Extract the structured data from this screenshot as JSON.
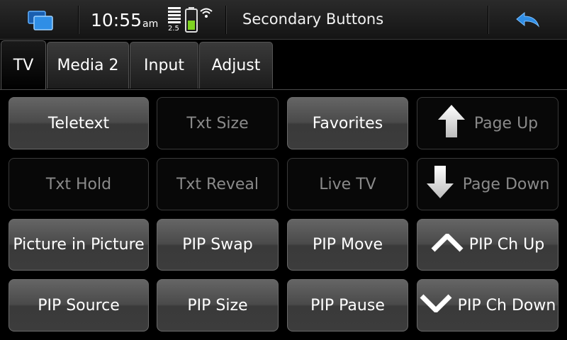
{
  "status": {
    "time": "10:55",
    "ampm": "am",
    "signal_label": "2.5",
    "title": "Secondary Buttons"
  },
  "icons": {
    "switcher": "task-switcher-icon",
    "back": "back-arrow-icon",
    "accent": "#2f8ee6"
  },
  "tabs": [
    {
      "label": "TV",
      "active": true
    },
    {
      "label": "Media 2",
      "active": false
    },
    {
      "label": "Input",
      "active": false
    },
    {
      "label": "Adjust",
      "active": false
    }
  ],
  "buttons": {
    "teletext": {
      "label": "Teletext",
      "enabled": true
    },
    "txt_size": {
      "label": "Txt Size",
      "enabled": false
    },
    "favorites": {
      "label": "Favorites",
      "enabled": true
    },
    "page_up": {
      "label": "Page Up",
      "enabled": false,
      "icon": "arrow-up-icon"
    },
    "txt_hold": {
      "label": "Txt Hold",
      "enabled": false
    },
    "txt_reveal": {
      "label": "Txt Reveal",
      "enabled": false
    },
    "live_tv": {
      "label": "Live TV",
      "enabled": false
    },
    "page_down": {
      "label": "Page Down",
      "enabled": false,
      "icon": "arrow-down-icon"
    },
    "pip": {
      "label": "Picture in Picture",
      "enabled": true
    },
    "pip_swap": {
      "label": "PIP Swap",
      "enabled": true
    },
    "pip_move": {
      "label": "PIP Move",
      "enabled": true
    },
    "pip_ch_up": {
      "label": "PIP Ch Up",
      "enabled": true,
      "icon": "chevron-up-icon"
    },
    "pip_source": {
      "label": "PIP Source",
      "enabled": true
    },
    "pip_size": {
      "label": "PIP Size",
      "enabled": true
    },
    "pip_pause": {
      "label": "PIP Pause",
      "enabled": true
    },
    "pip_ch_down": {
      "label": "PIP Ch Down",
      "enabled": true,
      "icon": "chevron-down-icon"
    }
  }
}
